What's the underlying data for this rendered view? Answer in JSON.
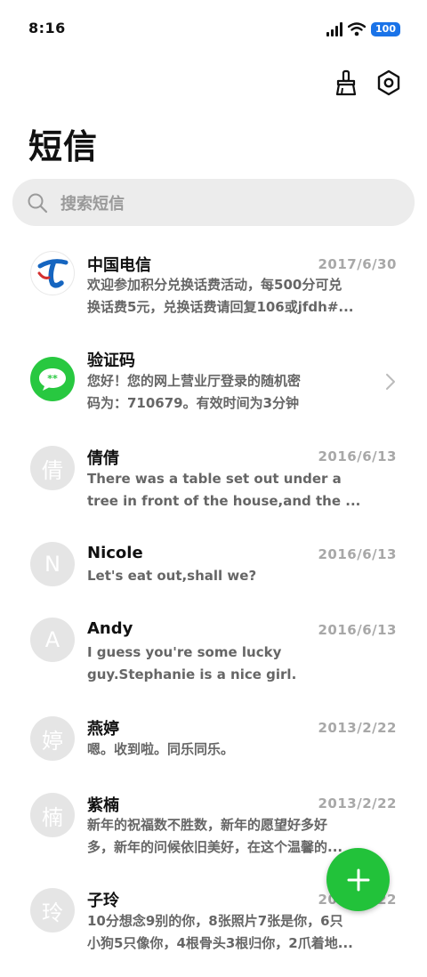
{
  "status_bar": {
    "time": "8:16",
    "battery": "100"
  },
  "header": {
    "title": "短信",
    "clean_icon": "broom-icon",
    "settings_icon": "settings-icon"
  },
  "search": {
    "placeholder": "搜索短信"
  },
  "messages": [
    {
      "sender": "中国电信",
      "date": "2017/6/30",
      "avatar_type": "logo",
      "preview_line1": "欢迎参加积分兑换话费活动，每500分可兑",
      "preview_line2": "换话费5元，兑换话费请回复106或jfdh#..."
    },
    {
      "sender": "验证码",
      "date": "",
      "avatar_type": "chat",
      "avatar_text": "**",
      "preview_line1": "您好！您的网上营业厅登录的随机密",
      "preview_line2": "码为：710679。有效时间为3分钟"
    },
    {
      "sender": "倩倩",
      "date": "2016/6/13",
      "avatar_text": "倩",
      "preview_line1": "There was a table set out under a",
      "preview_line2": "tree in front of the house,and the ..."
    },
    {
      "sender": "Nicole",
      "date": "2016/6/13",
      "avatar_text": "N",
      "preview_line1": "Let's eat out,shall we?",
      "preview_line2": ""
    },
    {
      "sender": "Andy",
      "date": "2016/6/13",
      "avatar_text": "A",
      "preview_line1": "I guess you're some lucky",
      "preview_line2": "guy.Stephanie is a nice girl."
    },
    {
      "sender": "燕婷",
      "date": "2013/2/22",
      "avatar_text": "婷",
      "preview_line1": "嗯。收到啦。同乐同乐。",
      "preview_line2": ""
    },
    {
      "sender": "紫楠",
      "date": "2013/2/22",
      "avatar_text": "楠",
      "preview_line1": "新年的祝福数不胜数，新年的愿望好多好",
      "preview_line2": "多，新年的问候依旧美好，在这个温馨的..."
    },
    {
      "sender": "子玲",
      "date": "2013/2/22",
      "avatar_text": "玲",
      "preview_line1": "10分想念9别的你，8张照片7张是你，6只",
      "preview_line2": "小狗5只像你，4根骨头3根归你，2爪着地..."
    }
  ],
  "fab": {
    "label": "+"
  }
}
